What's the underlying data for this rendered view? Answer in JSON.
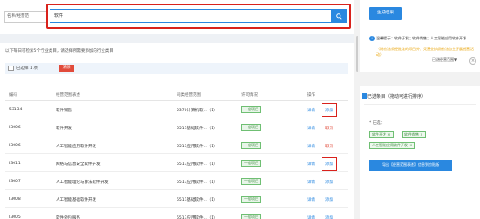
{
  "search": {
    "scope_label": "名称/经营范",
    "value": "软件",
    "button_icon": "search-icon"
  },
  "notice": "以下每日可检索5个行业类目，请选择所需要添加的行业类目",
  "selection": {
    "text": "已选择 1 项",
    "clear_label": "清除"
  },
  "table": {
    "columns": [
      "编码",
      "经营范围表述",
      "同类经营范围",
      "许可情况",
      "操作"
    ],
    "rows": [
      {
        "code": "53134",
        "name": "软件销售",
        "similar": "5370计算机软...（1）",
        "license": "一般项目",
        "detail": "详情",
        "op": "添加",
        "op_type": "add",
        "boxed": true
      },
      {
        "code": "I3006",
        "name": "软件开发",
        "similar": "6511基础软件...（1）",
        "license": "一般项目",
        "detail": "详情",
        "op": "取消",
        "op_type": "remove",
        "boxed": false
      },
      {
        "code": "I3006",
        "name": "人工智能应用软件开发",
        "similar": "6513应用软件...（1）",
        "license": "一般项目",
        "detail": "详情",
        "op": "取消",
        "op_type": "remove",
        "boxed": false
      },
      {
        "code": "I3011",
        "name": "网络与信息安全软件开发",
        "similar": "6513应用软件...（1）",
        "license": "一般项目",
        "detail": "详情",
        "op": "添加",
        "op_type": "add",
        "boxed": true
      },
      {
        "code": "I3007",
        "name": "人工智能理论与算法软件开发",
        "similar": "6513应用软件...（1）",
        "license": "一般项目",
        "detail": "详情",
        "op": "添加",
        "op_type": "add",
        "boxed": false
      },
      {
        "code": "I3008",
        "name": "人工智能基础软件开发",
        "similar": "6511基础软件...（1）",
        "license": "一般项目",
        "detail": "详情",
        "op": "添加",
        "op_type": "add",
        "boxed": false
      },
      {
        "code": "I3005",
        "name": "软件外包服务",
        "similar": "6513应用软件...（1）",
        "license": "一般项目",
        "detail": "详情",
        "op": "添加",
        "op_type": "add",
        "boxed": false
      }
    ]
  },
  "sidebar": {
    "generate_button": "生成结果",
    "info_main": "温馨提示：软件开发；软件销售；人工智能应用软件开发",
    "info_warn": "（除依法须经批准的项目外，凭营业执照依法自主开展经营活动）",
    "info_link": "已选经营范围▼",
    "close_icon": "close-icon",
    "selected_title": "已选条目（拖动可进行排序）",
    "chosen_label": "* 已选：",
    "chips": [
      "软件开发 ×",
      "软件销售 ×",
      "人工智能应用软件开发 ×"
    ],
    "export_button": "导出【经营范围表述】信息到剪贴板"
  },
  "colors": {
    "primary": "#2a88e0",
    "danger": "#e14b3b",
    "highlight_border": "#d9221c",
    "tag_green": "#3d8b40"
  }
}
